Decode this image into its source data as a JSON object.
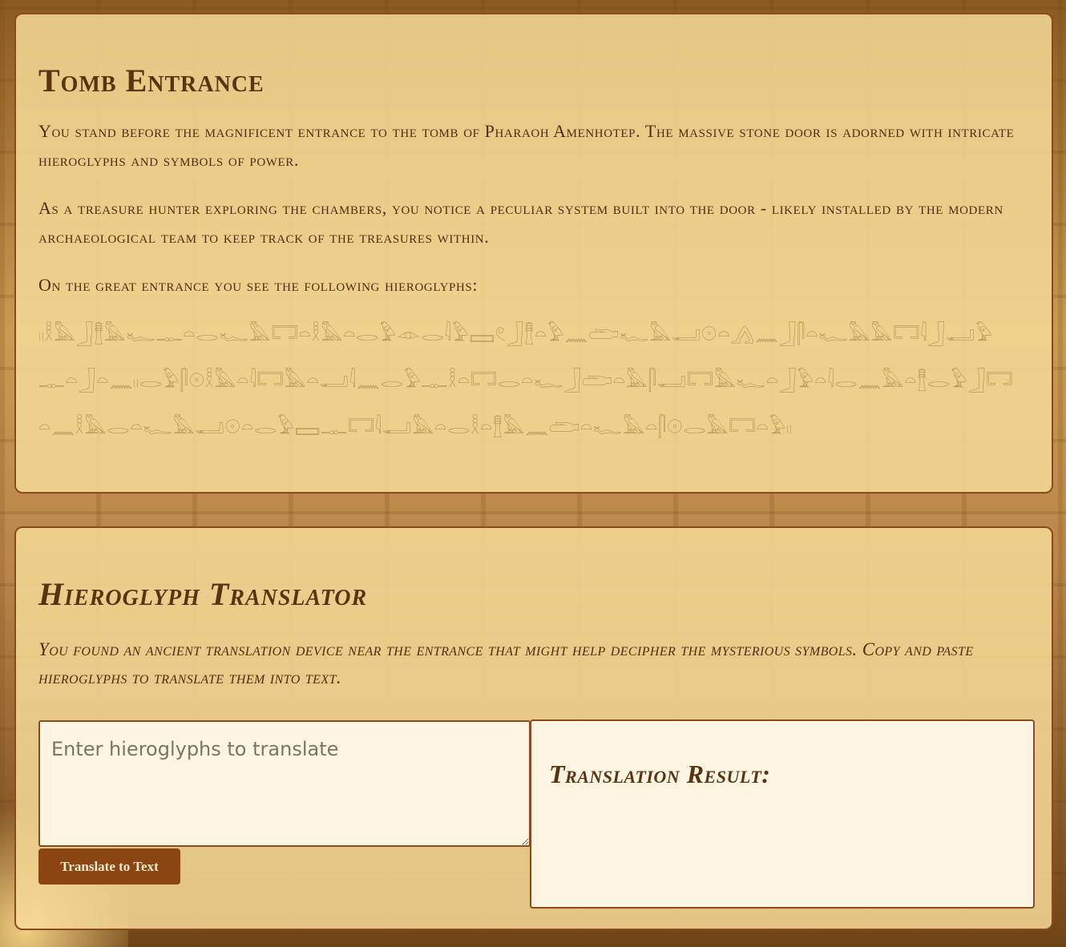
{
  "tomb": {
    "title": "Tomb Entrance",
    "paragraphs": [
      "You stand before the magnificent entrance to the tomb of Pharaoh Amenhotep. The massive stone door is adorned with intricate hieroglyphs and symbols of power.",
      "As a treasure hunter exploring the chambers, you notice a peculiar system built into the door - likely installed by the modern archaeological team to keep track of the treasures within.",
      "On the great entrance you see the following hieroglyphs:"
    ],
    "hieroglyphs": "𓏻𓎛𓅓𓃀𓊽𓅓𓆑𓊃𓏏𓂋𓆑𓅓𓉐𓏏𓎛𓅓𓏏𓂋𓅱𓁹𓂋𓇋𓅱𓈙𓏲𓃀𓊽𓏏𓅱𓈖𓂧𓆑𓅓𓂝𓇳𓏏𓂻𓈖𓃀𓋴𓏏𓆑𓅓𓅓𓉐𓇋𓃀𓂝𓅱𓊃𓏏𓃀𓏏𓈖𓏻𓂋𓅱𓋴𓇳𓎛𓅓𓏏𓇋𓉐𓅓𓏏𓂝𓇋𓈖𓂋𓅱𓊃𓎛𓏏𓉐𓂋𓏏𓆑𓃀𓂧𓏏𓅓𓋴𓂝𓉐𓅓𓆑𓏏𓃀𓅱𓏏𓇋𓂋𓈖𓅓𓏏𓊽𓂋𓅱𓃀𓉐𓏏𓈖𓎛𓅓𓂋𓏏𓆑𓅓𓂝𓇳𓏏𓂋𓅱𓈙𓊃𓉐𓇋𓂝𓅓𓏏𓂋𓎛𓏏𓊽𓅓𓈖𓂧𓏏𓆑𓅓𓏏𓋴𓇳𓂋𓅓𓉐𓏏𓅱𓏻"
  },
  "translator": {
    "title": "Hieroglyph Translator",
    "description": "You found an ancient translation device near the entrance that might help decipher the mysterious symbols. Copy and paste hieroglyphs to translate them into text.",
    "input_placeholder": "Enter hieroglyphs to translate",
    "input_value": "",
    "button_label": "Translate to Text",
    "result_title": "Translation Result:"
  },
  "colors": {
    "accent": "#8b4513",
    "panel_border": "#8b4a1e",
    "heading": "#5a3311"
  }
}
